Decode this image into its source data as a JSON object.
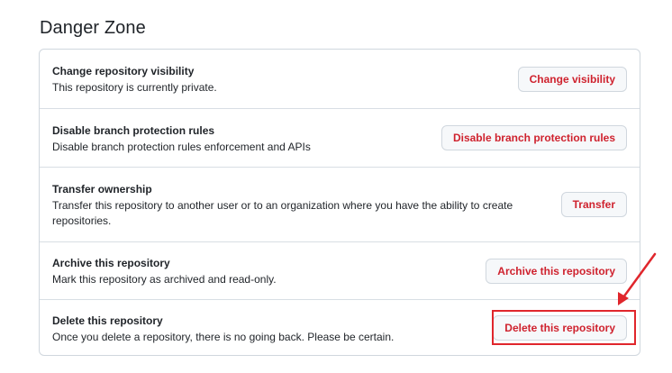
{
  "page": {
    "title": "Danger Zone"
  },
  "rows": [
    {
      "heading": "Change repository visibility",
      "description": "This repository is currently private.",
      "button": "Change visibility"
    },
    {
      "heading": "Disable branch protection rules",
      "description": "Disable branch protection rules enforcement and APIs",
      "button": "Disable branch protection rules"
    },
    {
      "heading": "Transfer ownership",
      "description": "Transfer this repository to another user or to an organization where you have the ability to create repositories.",
      "button": "Transfer"
    },
    {
      "heading": "Archive this repository",
      "description": "Mark this repository as archived and read-only.",
      "button": "Archive this repository"
    },
    {
      "heading": "Delete this repository",
      "description": "Once you delete a repository, there is no going back. Please be certain.",
      "button": "Delete this repository"
    }
  ],
  "colors": {
    "danger_text": "#cf222e",
    "annotation": "#e0262c",
    "border": "#d0d7de",
    "button_bg": "#f6f8fa"
  },
  "annotation": {
    "type": "arrow-and-box",
    "target": "delete-repository-button"
  }
}
